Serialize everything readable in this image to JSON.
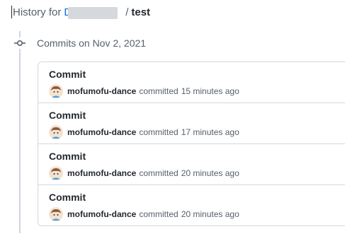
{
  "header": {
    "prefix": "History for",
    "repo_owner": "D",
    "separator": "/",
    "repo_name": "test"
  },
  "timeline": {
    "date_label": "Commits on Nov 2, 2021"
  },
  "commits": [
    {
      "title": "Commit",
      "author": "mofumofu-dance",
      "action": "committed",
      "time": "15 minutes ago"
    },
    {
      "title": "Commit",
      "author": "mofumofu-dance",
      "action": "committed",
      "time": "17 minutes ago"
    },
    {
      "title": "Commit",
      "author": "mofumofu-dance",
      "action": "committed",
      "time": "20 minutes ago"
    },
    {
      "title": "Commit",
      "author": "mofumofu-dance",
      "action": "committed",
      "time": "20 minutes ago"
    }
  ],
  "colors": {
    "link": "#0969da",
    "muted": "#57606a",
    "border": "#d0d7de"
  }
}
